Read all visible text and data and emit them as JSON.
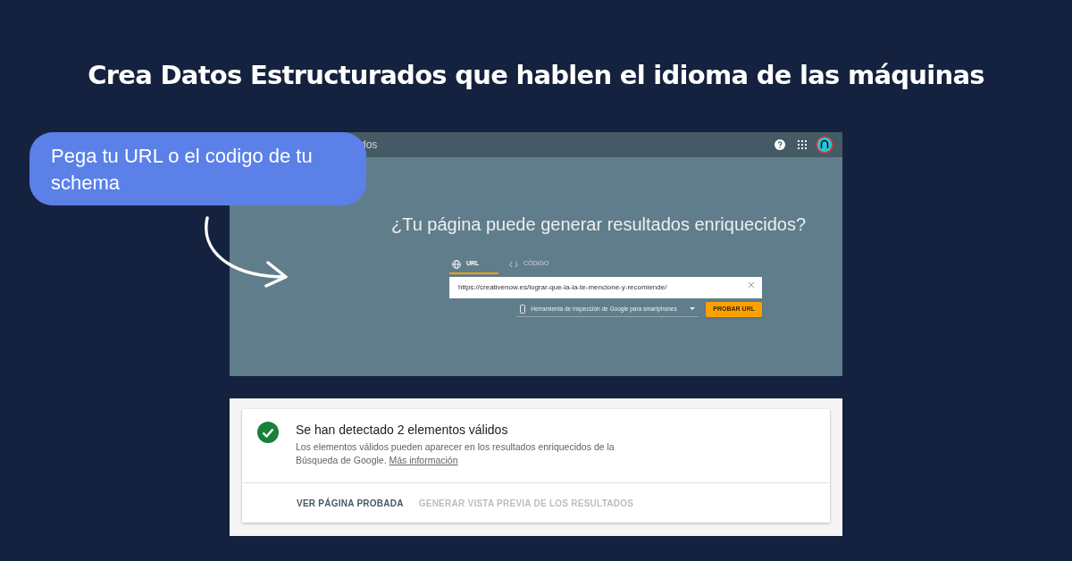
{
  "headline": "Crea Datos Estructurados que hablen el idioma de las máquinas",
  "callout": "Pega tu URL o el codigo de tu schema",
  "tool": {
    "top_bar": {
      "title": "dos"
    },
    "heading": "¿Tu página puede generar resultados enriquecidos?",
    "tabs": [
      {
        "label": "URL",
        "kind": "globe",
        "selected": true
      },
      {
        "label": "CÓDIGO",
        "kind": "code",
        "selected": false
      }
    ],
    "url_field": {
      "value": "https://creativenow.es/lograr-que-la-ia-te-mencione-y-recomiende/"
    },
    "agent_select": {
      "value": "Herramienta de inspección de Google para smartphones"
    },
    "test_button": "PROBAR URL"
  },
  "result": {
    "title": "Se han detectado 2 elementos válidos",
    "description": "Los elementos válidos pueden aparecer en los resultados enriquecidos de la Búsqueda de Google.",
    "link": "Más información",
    "actions": [
      {
        "label": "VER PÁGINA PROBADA",
        "disabled": false
      },
      {
        "label": "GENERAR VISTA PREVIA DE LOS RESULTADOS",
        "disabled": true
      }
    ]
  }
}
